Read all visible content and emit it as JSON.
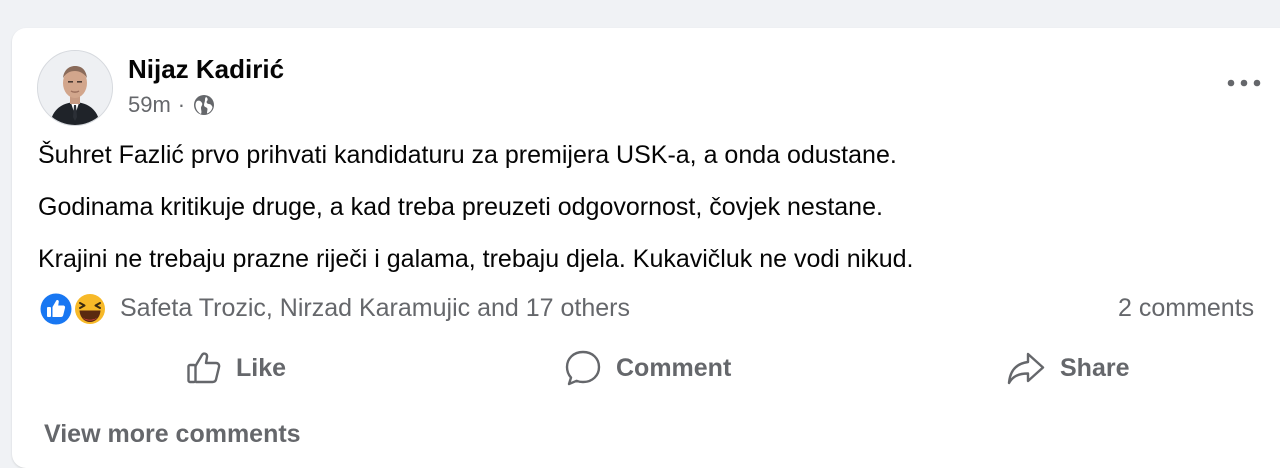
{
  "post": {
    "author": "Nijaz Kadirić",
    "time": "59m",
    "separator": "·",
    "audience_icon": "globe-icon",
    "more_icon": "more-options-icon",
    "text_lines": [
      "Šuhret Fazlić prvo prihvati kandidaturu za premijera USK-a, a onda odustane.",
      "Godinama kritikuje druge, a kad treba preuzeti odgovornost, čovjek nestane.",
      "Krajini ne trebaju prazne riječi i galama, trebaju djela. Kukavičluk ne vodi nikud."
    ]
  },
  "reactions": {
    "icons": [
      "like-reaction-icon",
      "haha-reaction-icon"
    ],
    "names": "Safeta Trozic, Nirzad Karamujic and 17 others",
    "comments_count": "2 comments"
  },
  "actions": {
    "like": "Like",
    "comment": "Comment",
    "share": "Share"
  },
  "view_more": "View more comments",
  "colors": {
    "like_blue": "#1877f2",
    "haha_yellow": "#f7b928",
    "secondary_text": "#65676b",
    "primary_text": "#050505",
    "page_background": "#f0f2f5"
  }
}
